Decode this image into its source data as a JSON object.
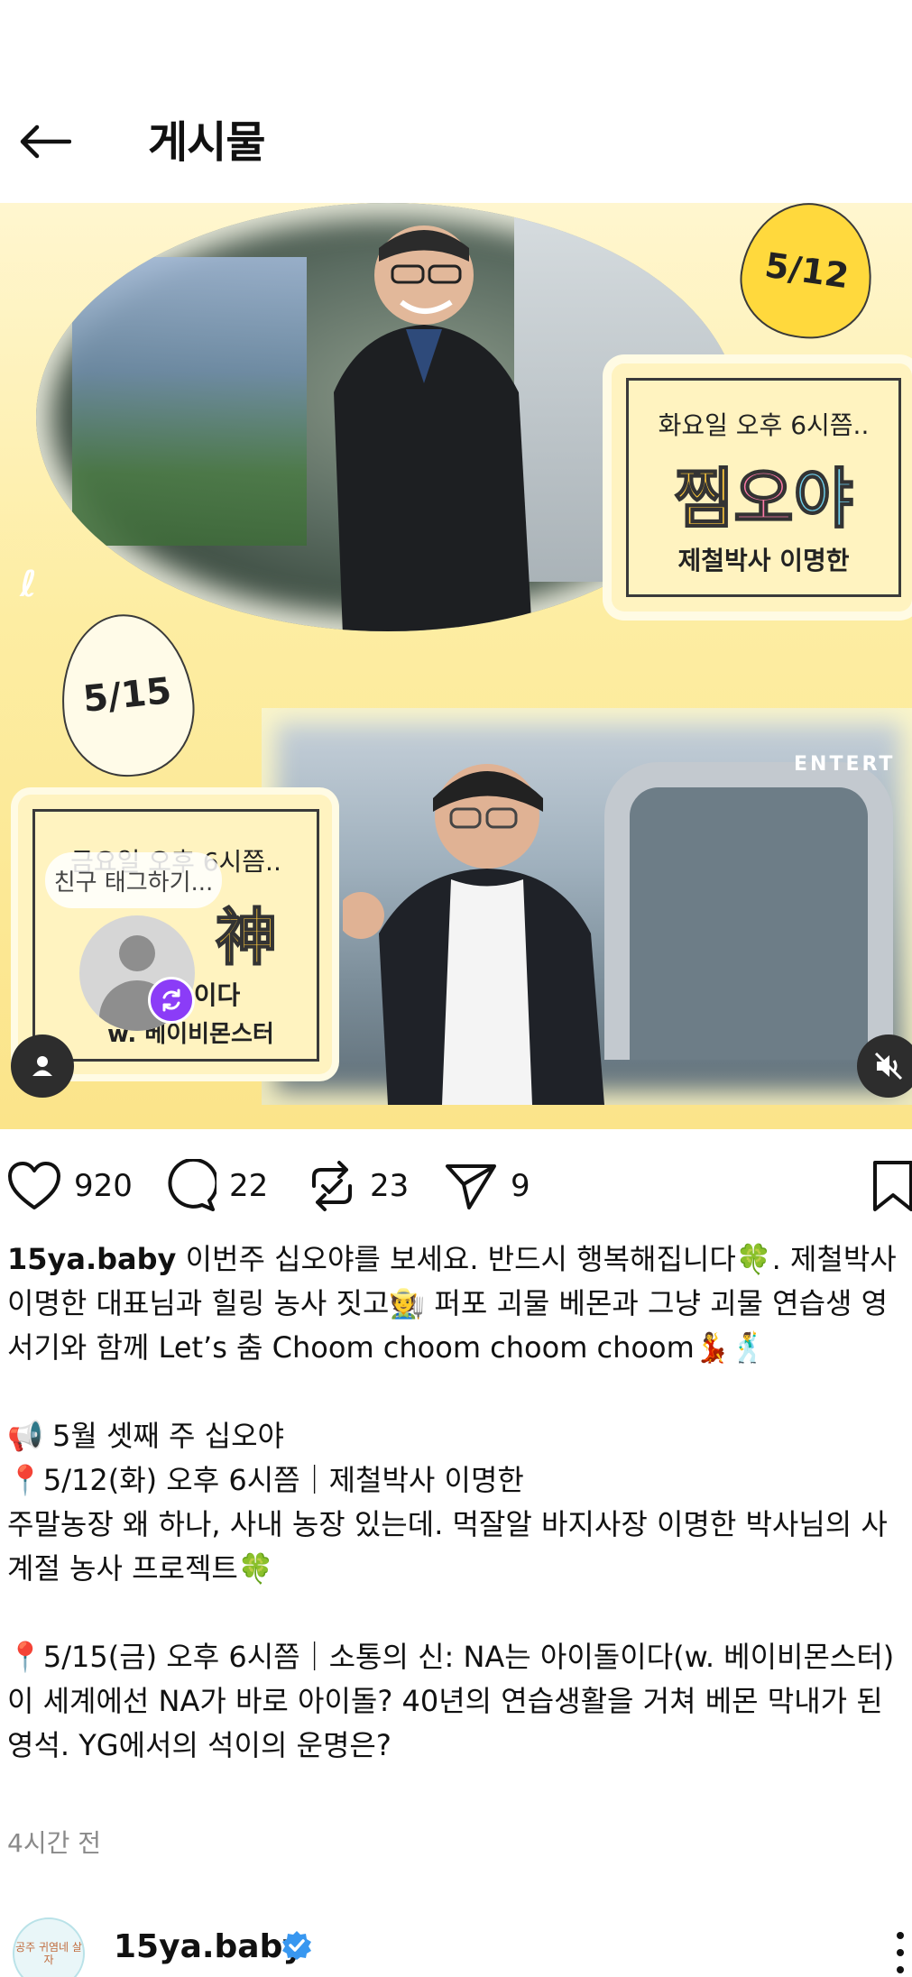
{
  "header": {
    "title": "게시물"
  },
  "media": {
    "egg1_label": "5/12",
    "egg2_label": "5/15",
    "card1": {
      "time": "화요일 오후 6시쯤..",
      "big_a": "찜",
      "big_b": "오",
      "big_c": "야",
      "guest": "제철박사 이명한"
    },
    "card2": {
      "time": "금요일 오후 6시쯤..",
      "shin": "神",
      "line1": "돌이다",
      "line2": "w. 베이비몬스터"
    },
    "tag_bubble": "친구 태그하기...",
    "building_brand": "ENTERT"
  },
  "actions": {
    "likes": "920",
    "comments": "22",
    "reposts": "23",
    "shares": "9"
  },
  "caption": {
    "username": "15ya.baby",
    "text": " 이번주 십오야를 보세요. 반드시 행복해집니다🍀. 제철박사 이명한 대표님과 힐링 농사 짓고🧑‍🌾 퍼포 괴물 베몬과 그냥 괴물 연습생 영서기와 함께 Let’s 춤 Choom choom choom choom💃🕺\n\n📢 5월 셋째 주 십오야\n📍5/12(화) 오후 6시쯤｜제철박사 이명한\n주말농장 왜 하나, 사내 농장 있는데. 먹잘알 바지사장 이명한 박사님의 사계절 농사 프로젝트🍀\n\n📍5/15(금) 오후 6시쯤｜소통의 신: NA는 아이돌이다(w. 베이비몬스터)\n이 세계에선 NA가 바로 아이돌? 40년의 연습생활을 거쳐 베몬 막내가 된 영석. YG에서의 석이의 운명은?"
  },
  "timestamp": "4시간 전",
  "author": {
    "name": "15ya.baby",
    "avatar_text": "공주 귀염네 살자"
  },
  "colors": {
    "accent_purple": "#8b3cf7",
    "verified_blue": "#3897f0",
    "media_yellow": "#fbe48a"
  }
}
